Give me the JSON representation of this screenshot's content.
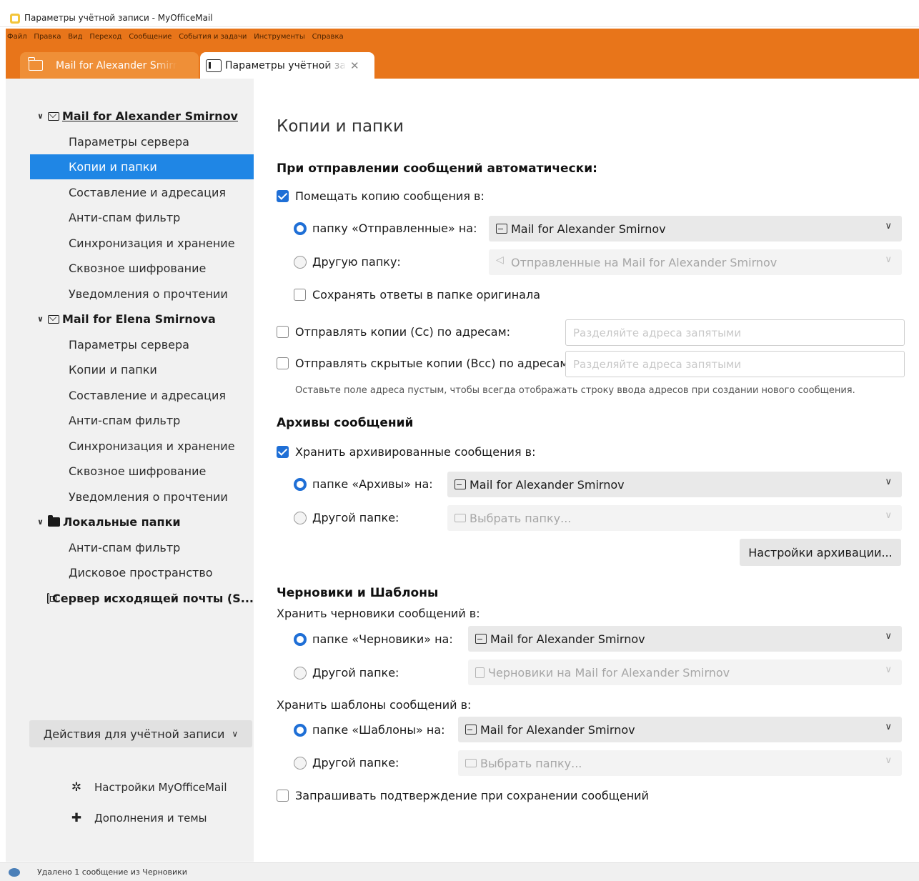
{
  "window": {
    "title": "Параметры учётной записи - MyOfficeMail"
  },
  "menu": [
    "Файл",
    "Правка",
    "Вид",
    "Переход",
    "Сообщение",
    "События и задачи",
    "Инструменты",
    "Справка"
  ],
  "tabs": {
    "mail": "Mail for Alexander Smirnov",
    "settings": "Параметры учётной записи"
  },
  "sidebar": {
    "account1": {
      "name": "Mail for Alexander Smirnov",
      "items": [
        "Параметры сервера",
        "Копии и папки",
        "Составление и адресация",
        "Анти-спам фильтр",
        "Синхронизация и хранение",
        "Сквозное шифрование",
        "Уведомления о прочтении"
      ]
    },
    "account2": {
      "name": "Mail for Elena Smirnova",
      "items": [
        "Параметры сервера",
        "Копии и папки",
        "Составление и адресация",
        "Анти-спам фильтр",
        "Синхронизация и хранение",
        "Сквозное шифрование",
        "Уведомления о прочтении"
      ]
    },
    "local": {
      "name": "Локальные папки",
      "items": [
        "Анти-спам фильтр",
        "Дисковое пространство"
      ]
    },
    "outgoing": "Сервер исходящей почты (S...",
    "actions": "Действия для учётной записи",
    "links": {
      "settings": "Настройки MyOfficeMail",
      "addons": "Дополнения и темы"
    }
  },
  "main": {
    "title": "Копии и папки",
    "sending": {
      "heading": "При отправлении сообщений автоматически:",
      "place_copy": {
        "label": "Помещать копию сообщения в:",
        "checked": true
      },
      "sent_folder": {
        "label": "папку «Отправленные» на:",
        "value": "Mail for Alexander Smirnov",
        "selected": true
      },
      "other_folder": {
        "label": "Другую папку:",
        "value": "Отправленные на Mail for Alexander Smirnov",
        "selected": false
      },
      "keep_replies": {
        "label": "Сохранять ответы в папке оригинала",
        "checked": false
      },
      "cc": {
        "label": "Отправлять копии (Cc) по адресам:",
        "placeholder": "Разделяйте адреса запятыми",
        "checked": false
      },
      "bcc": {
        "label": "Отправлять скрытые копии (Bcc) по адресам:",
        "placeholder": "Разделяйте адреса запятыми",
        "checked": false
      },
      "hint": "Оставьте поле адреса пустым, чтобы всегда отображать строку ввода адресов при создании нового сообщения."
    },
    "archives": {
      "heading": "Архивы сообщений",
      "keep": {
        "label": "Хранить архивированные сообщения в:",
        "checked": true
      },
      "archive_folder": {
        "label": "папке «Архивы» на:",
        "value": "Mail for Alexander Smirnov",
        "selected": true
      },
      "other_folder": {
        "label": "Другой папке:",
        "value": "Выбрать папку...",
        "selected": false
      },
      "settings_button": "Настройки архивации..."
    },
    "drafts": {
      "heading": "Черновики и Шаблоны",
      "drafts_label": "Хранить черновики сообщений в:",
      "drafts_folder": {
        "label": "папке «Черновики» на:",
        "value": "Mail for Alexander Smirnov",
        "selected": true
      },
      "drafts_other": {
        "label": "Другой папке:",
        "value": "Черновики на Mail for Alexander Smirnov",
        "selected": false
      },
      "templates_label": "Хранить шаблоны сообщений в:",
      "templates_folder": {
        "label": "папке «Шаблоны» на:",
        "value": "Mail for Alexander Smirnov",
        "selected": true
      },
      "templates_other": {
        "label": "Другой папке:",
        "value": "Выбрать папку...",
        "selected": false
      },
      "confirm_save": {
        "label": "Запрашивать подтверждение при сохранении сообщений",
        "checked": false
      }
    }
  },
  "status": {
    "text": "Удалено 1 сообщение из Черновики"
  },
  "colors": {
    "accent_orange": "#e8751a",
    "selection_blue": "#1f86e5",
    "checkbox_blue": "#1f6fd6"
  }
}
